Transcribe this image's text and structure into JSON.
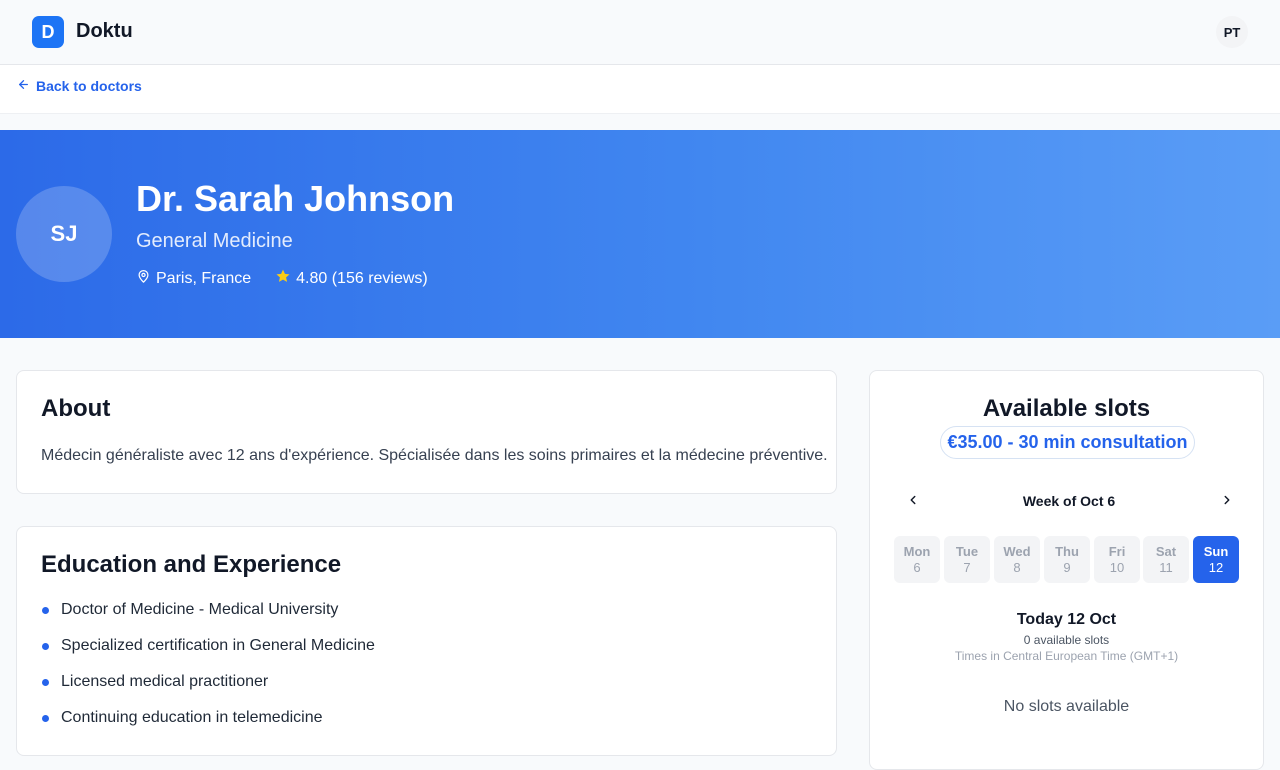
{
  "header": {
    "logo_letter": "D",
    "brand": "Doktu",
    "user_initials": "PT"
  },
  "nav": {
    "back_label": "Back to doctors"
  },
  "doctor": {
    "initials": "SJ",
    "name": "Dr. Sarah Johnson",
    "specialty": "General Medicine",
    "location": "Paris, France",
    "rating_text": "4.80 (156 reviews)"
  },
  "about": {
    "title": "About",
    "text": "Médecin généraliste avec 12 ans d'expérience. Spécialisée dans les soins primaires et la médecine préventive."
  },
  "education": {
    "title": "Education and Experience",
    "items": [
      "Doctor of Medicine - Medical University",
      "Specialized certification in General Medicine",
      "Licensed medical practitioner",
      "Continuing education in telemedicine"
    ]
  },
  "slots": {
    "title": "Available slots",
    "price": "€35.00 - 30 min consultation",
    "week_label": "Week of Oct 6",
    "days": [
      {
        "name": "Mon",
        "num": "6"
      },
      {
        "name": "Tue",
        "num": "7"
      },
      {
        "name": "Wed",
        "num": "8"
      },
      {
        "name": "Thu",
        "num": "9"
      },
      {
        "name": "Fri",
        "num": "10"
      },
      {
        "name": "Sat",
        "num": "11"
      },
      {
        "name": "Sun",
        "num": "12"
      }
    ],
    "selected_day": "Sun",
    "today_title": "Today 12 Oct",
    "available_count": "0 available slots",
    "timezone_note": "Times in Central European Time (GMT+1)",
    "empty_text": "No slots available"
  },
  "colors": {
    "accent": "#2563eb",
    "brand": "#1d74f5",
    "star": "#facc15"
  },
  "icons": {
    "back": "arrow-left-icon",
    "location": "map-pin-icon",
    "rating": "star-icon",
    "prev": "chevron-left-icon",
    "next": "chevron-right-icon"
  }
}
